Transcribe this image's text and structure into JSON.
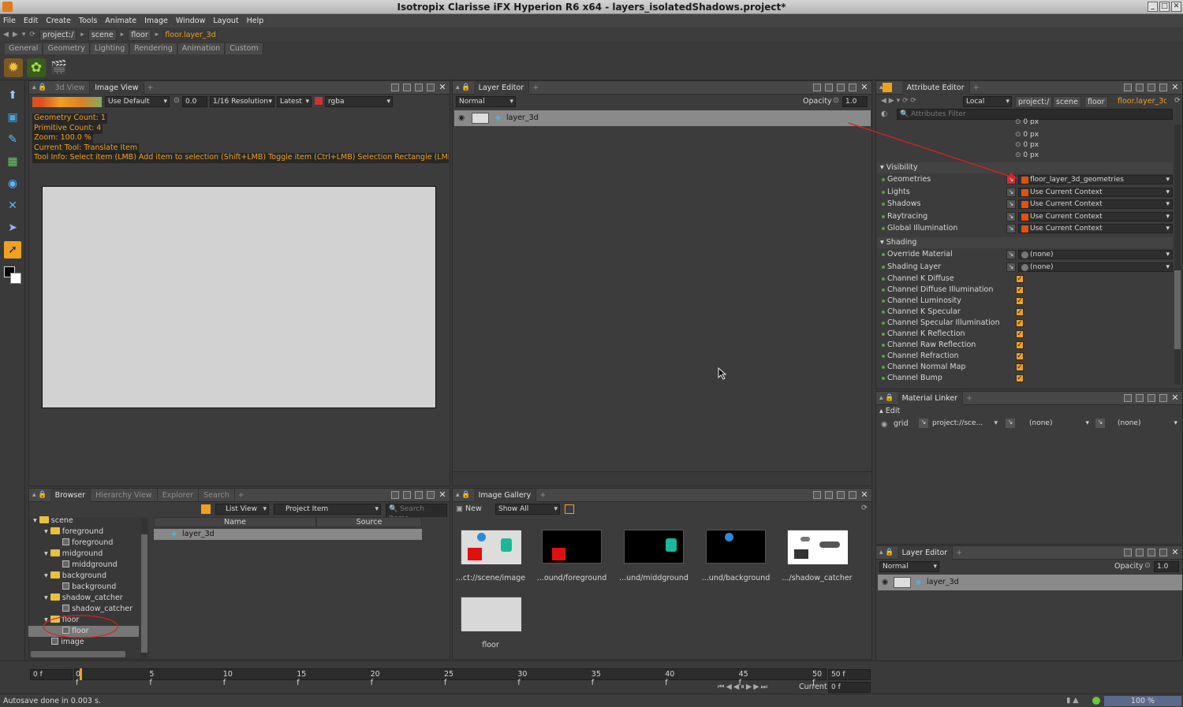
{
  "window": {
    "title": "Isotropix Clarisse iFX Hyperion R6 x64  - layers_isolatedShadows.project*"
  },
  "menu": [
    "File",
    "Edit",
    "Create",
    "Tools",
    "Animate",
    "Image",
    "Window",
    "Layout",
    "Help"
  ],
  "path": {
    "items": [
      "project:/",
      "scene",
      "floor"
    ],
    "current": "floor.layer_3d"
  },
  "shelf_tabs": [
    "General",
    "Geometry",
    "Lighting",
    "Rendering",
    "Animation",
    "Custom"
  ],
  "viewport": {
    "tabs": [
      "3d View",
      "Image View"
    ],
    "display": "Use Default",
    "exposure": "0.0",
    "resolution": "1/16 Resolution",
    "mode": "Latest",
    "channel": "rgba",
    "overlay": [
      "Geometry Count: 1",
      "Primitive Count: 4",
      "Zoom: 100.0 %",
      "Current Tool: Translate Item"
    ],
    "tool_info": "Tool Info: Select item (LMB)  Add item to selection (Shift+LMB)  Toggle item (Ctrl+LMB)  Selection Rectangle (LMB-Drag"
  },
  "layer_editor": {
    "title": "Layer Editor",
    "blend": "Normal",
    "opacity_label": "Opacity",
    "opacity": "1.0",
    "layer_name": "layer_3d"
  },
  "attribute_editor": {
    "title": "Attribute Editor",
    "space": "Local",
    "path": [
      "project:/",
      "scene",
      "floor"
    ],
    "current": "floor.layer_3d",
    "filter_placeholder": "Attributes Filter",
    "px_values": [
      "0 px",
      "0 px",
      "0 px",
      "0 px"
    ],
    "visibility_header": "Visibility",
    "visibility": [
      {
        "label": "Geometries",
        "value": "floor_layer_3d_geometries"
      },
      {
        "label": "Lights",
        "value": "Use Current Context"
      },
      {
        "label": "Shadows",
        "value": "Use Current Context"
      },
      {
        "label": "Raytracing",
        "value": "Use Current Context"
      },
      {
        "label": "Global Illumination",
        "value": "Use Current Context"
      }
    ],
    "shading_header": "Shading",
    "shading": [
      {
        "label": "Override Material",
        "value": "(none)"
      },
      {
        "label": "Shading Layer",
        "value": "(none)"
      }
    ],
    "channels": [
      "Channel K Diffuse",
      "Channel Diffuse Illumination",
      "Channel Luminosity",
      "Channel K Specular",
      "Channel Specular Illumination",
      "Channel K Reflection",
      "Channel Raw Reflection",
      "Channel Refraction",
      "Channel Normal Map",
      "Channel Bump"
    ]
  },
  "material_linker": {
    "title": "Material Linker",
    "edit": "Edit",
    "row": {
      "name": "grid",
      "material": "project://sce...",
      "col2": "(none)",
      "col3": "(none)"
    }
  },
  "layer_editor2": {
    "title": "Layer Editor",
    "blend": "Normal",
    "opacity_label": "Opacity",
    "opacity": "1.0",
    "layer_name": "layer_3d"
  },
  "browser": {
    "tabs": [
      "Browser",
      "Hierarchy View",
      "Explorer",
      "Search"
    ],
    "view": "List View",
    "filter": "Project Item",
    "search_placeholder": "Search Items",
    "tree": [
      {
        "label": "scene",
        "kind": "folder",
        "indent": 0
      },
      {
        "label": "foreground",
        "kind": "folder",
        "indent": 1
      },
      {
        "label": "foreground",
        "kind": "item",
        "indent": 2
      },
      {
        "label": "midground",
        "kind": "folder",
        "indent": 1
      },
      {
        "label": "middground",
        "kind": "item",
        "indent": 2
      },
      {
        "label": "background",
        "kind": "folder",
        "indent": 1
      },
      {
        "label": "background",
        "kind": "item",
        "indent": 2
      },
      {
        "label": "shadow_catcher",
        "kind": "folder",
        "indent": 1
      },
      {
        "label": "shadow_catcher",
        "kind": "item",
        "indent": 2
      },
      {
        "label": "floor",
        "kind": "folder",
        "indent": 1
      },
      {
        "label": "floor",
        "kind": "item",
        "indent": 2
      },
      {
        "label": "image",
        "kind": "item",
        "indent": 1
      }
    ],
    "columns": [
      "Name",
      "Source"
    ],
    "rows": [
      "layer_3d"
    ]
  },
  "image_gallery": {
    "title": "Image Gallery",
    "new": "New",
    "filter": "Show All",
    "items": [
      "...ct://scene/image",
      "...ound/foreground",
      "...und/middground",
      "...und/background",
      ".../shadow_catcher",
      "floor"
    ]
  },
  "timeline": {
    "start": "0 f",
    "end": "50 f",
    "ticks": [
      "0 f",
      "5 f",
      "10 f",
      "15 f",
      "20 f",
      "25 f",
      "30 f",
      "35 f",
      "40 f",
      "45 f",
      "50 f"
    ],
    "current_label": "Current",
    "current": "0 f"
  },
  "status": {
    "message": "Autosave done in 0.003 s.",
    "progress": "100 %"
  },
  "colors": {
    "accent": "#f0a020",
    "background": "#3c3c3c",
    "annotation": "#e02020"
  }
}
